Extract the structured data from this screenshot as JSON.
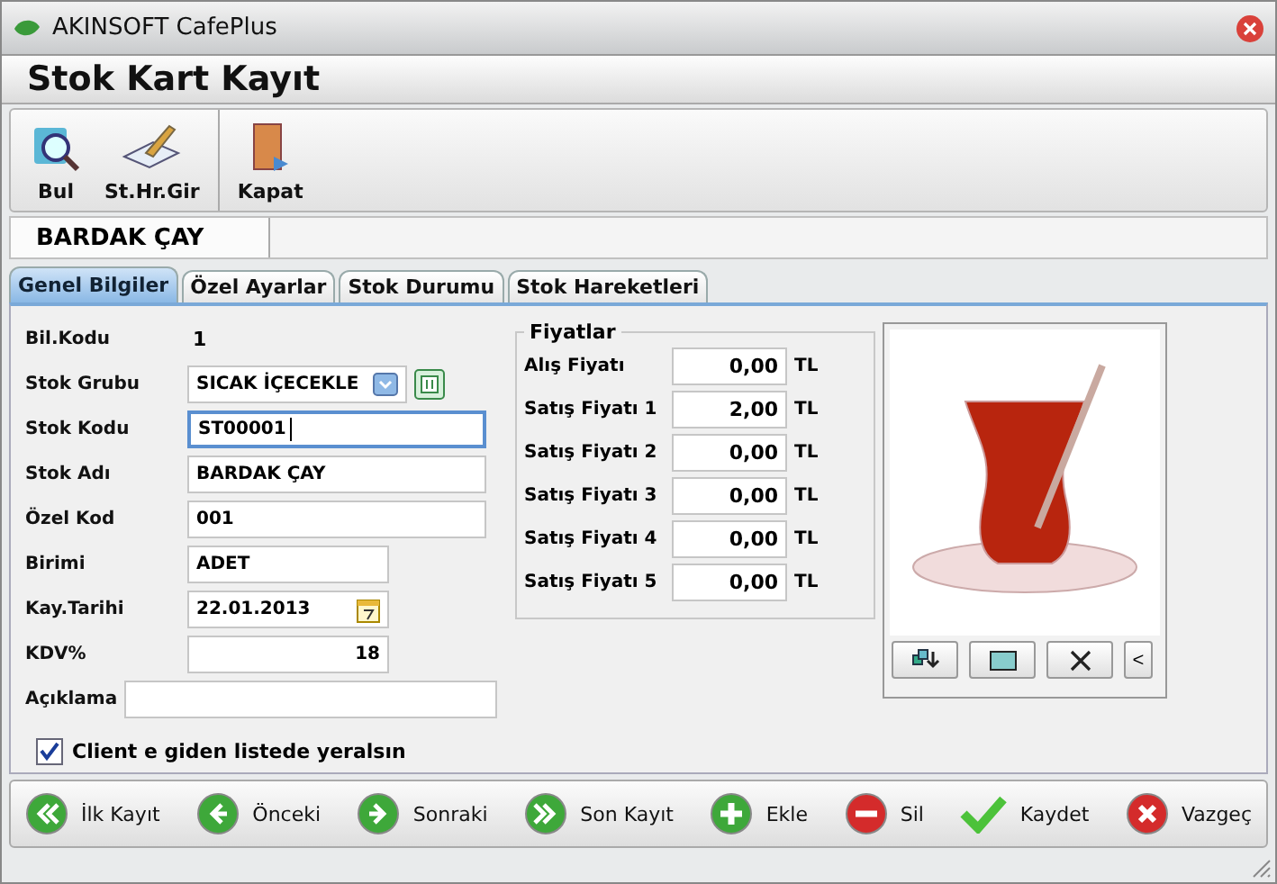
{
  "window": {
    "title": "AKINSOFT CafePlus"
  },
  "form_title": "Stok Kart Kayıt",
  "toolbar": [
    {
      "label": "Bul",
      "kind": "search"
    },
    {
      "label": "St.Hr.Gir",
      "kind": "book"
    },
    {
      "label": "Kapat",
      "kind": "exit"
    }
  ],
  "record_tab": "BARDAK ÇAY",
  "tabs": [
    {
      "label": "Genel Bilgiler",
      "selected": true
    },
    {
      "label": "Özel Ayarlar",
      "selected": false
    },
    {
      "label": "Stok Durumu",
      "selected": false
    },
    {
      "label": "Stok Hareketleri",
      "selected": false
    }
  ],
  "fields": [
    {
      "label": "Bil.Kodu",
      "value": "1",
      "kind": "static"
    },
    {
      "label": "Stok Grubu",
      "value": "SICAK İÇECEKLE",
      "kind": "combo",
      "focused": false
    },
    {
      "label": "Stok Kodu",
      "value": "ST00001",
      "kind": "text",
      "focused": true
    },
    {
      "label": "Stok Adı",
      "value": "BARDAK ÇAY",
      "kind": "text",
      "focused": false
    },
    {
      "label": "Özel Kod",
      "value": "001",
      "kind": "text",
      "focused": false
    },
    {
      "label": "Birimi",
      "value": "ADET",
      "kind": "short",
      "focused": false
    },
    {
      "label": "Kay.Tarihi",
      "value": "22.01.2013",
      "kind": "date",
      "focused": false
    },
    {
      "label": "KDV%",
      "value": "18",
      "kind": "number",
      "focused": false
    },
    {
      "label": "Açıklama",
      "kind": "memo",
      "focused": false
    }
  ],
  "prices": {
    "title": "Fiyatlar",
    "items": [
      {
        "label": "Alış Fiyatı",
        "value": "0,00",
        "currency": "TL"
      },
      {
        "label": "Satış Fiyatı 1",
        "value": "2,00",
        "currency": "TL"
      },
      {
        "label": "Satış Fiyatı 2",
        "value": "0,00",
        "currency": "TL"
      },
      {
        "label": "Satış Fiyatı 3",
        "value": "0,00",
        "currency": "TL"
      },
      {
        "label": "Satış Fiyatı 4",
        "value": "0,00",
        "currency": "TL"
      },
      {
        "label": "Satış Fiyatı 5",
        "value": "0,00",
        "currency": "TL"
      }
    ]
  },
  "image_buttons": [
    {
      "kind": "load"
    },
    {
      "kind": "view"
    },
    {
      "kind": "delete"
    },
    {
      "kind": "collapse",
      "text": "<"
    }
  ],
  "checkbox": {
    "label": "Client e giden listede yeralsın",
    "checked": true
  },
  "nav_buttons": [
    {
      "label": "İlk Kayıt",
      "kind": "first"
    },
    {
      "label": "Önceki",
      "kind": "prev"
    },
    {
      "label": "Sonraki",
      "kind": "next"
    },
    {
      "label": "Son Kayıt",
      "kind": "last"
    },
    {
      "label": "Ekle",
      "kind": "add"
    },
    {
      "label": "Sil",
      "kind": "delete"
    },
    {
      "label": "Kaydet",
      "kind": "save"
    },
    {
      "label": "Vazgeç",
      "kind": "cancel"
    }
  ]
}
